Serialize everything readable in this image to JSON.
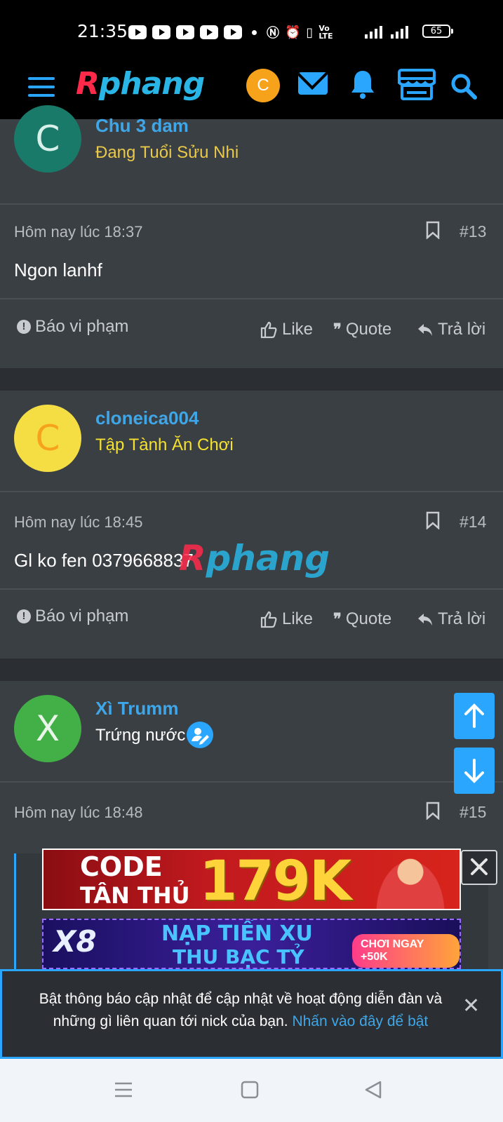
{
  "status_bar": {
    "time": "21:35",
    "battery": "65",
    "network": "4G"
  },
  "header": {
    "logo_r": "R",
    "logo_rest": "phang",
    "avatar_letter": "C",
    "accent": "#2aa6ff"
  },
  "posts": [
    {
      "username": "Chu 3 dam",
      "title": "Đang Tuổi Sửu Nhi",
      "avatar_letter": "C",
      "avatar_bg": "#1a7a6a",
      "title_color": "#e9c84a",
      "time": "Hôm nay lúc 18:37",
      "number": "#13",
      "content": "Ngon lanhf"
    },
    {
      "username": "cloneica004",
      "title": "Tập Tành Ăn Chơi",
      "avatar_letter": "C",
      "avatar_bg": "#f5dd44",
      "title_color": "#f5e12e",
      "time": "Hôm nay lúc 18:45",
      "number": "#14",
      "content": "Gl ko fen 0379668837"
    },
    {
      "username": "Xì Trumm",
      "title": "Trứng nước",
      "avatar_letter": "X",
      "avatar_bg": "#43b047",
      "title_color": "#ffffff",
      "time": "Hôm nay lúc 18:48",
      "number": "#15"
    }
  ],
  "actions": {
    "report": "Báo vi phạm",
    "like": "Like",
    "quote": "Quote",
    "reply": "Trả lời"
  },
  "watermark": {
    "r": "R",
    "rest": "phang"
  },
  "ads": {
    "ad1_code": "CODE",
    "ad1_tanthu": "TÂN THỦ",
    "ad1_amount": "179K",
    "ad2_brand": "X8",
    "ad2_line1": "NẠP TIỀN XU",
    "ad2_line2": "THU BẠC TỶ",
    "ad2_cta": "CHƠI NGAY +50K"
  },
  "notification": {
    "text": "Bật thông báo cập nhật để cập nhật về hoạt động diễn đàn và những gì liên quan tới nick của bạn. ",
    "link": "Nhấn vào đây để bật"
  }
}
